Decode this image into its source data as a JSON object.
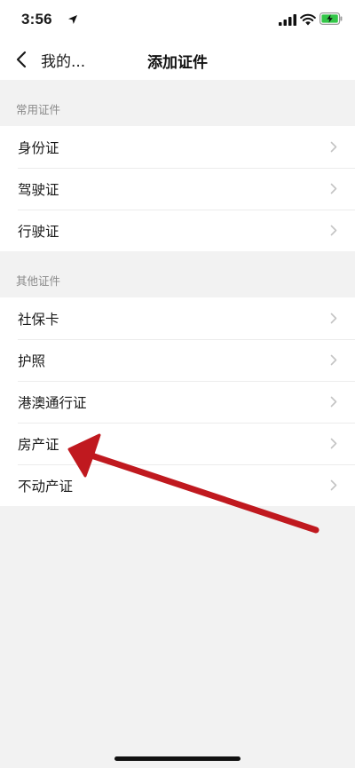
{
  "status_bar": {
    "time": "3:56",
    "icons": [
      "location-arrow-icon",
      "cellular-signal-icon",
      "wifi-icon",
      "battery-charging-icon"
    ]
  },
  "nav": {
    "back_label": "我的...",
    "title": "添加证件"
  },
  "sections": [
    {
      "header": "常用证件",
      "items": [
        "身份证",
        "驾驶证",
        "行驶证"
      ]
    },
    {
      "header": "其他证件",
      "items": [
        "社保卡",
        "护照",
        "港澳通行证",
        "房产证",
        "不动产证"
      ]
    }
  ],
  "colors": {
    "background": "#f2f2f2",
    "list_bg": "#ffffff",
    "section_text": "#8a8a8a",
    "annotation_arrow": "#c0191f",
    "battery_charge": "#33c648"
  }
}
